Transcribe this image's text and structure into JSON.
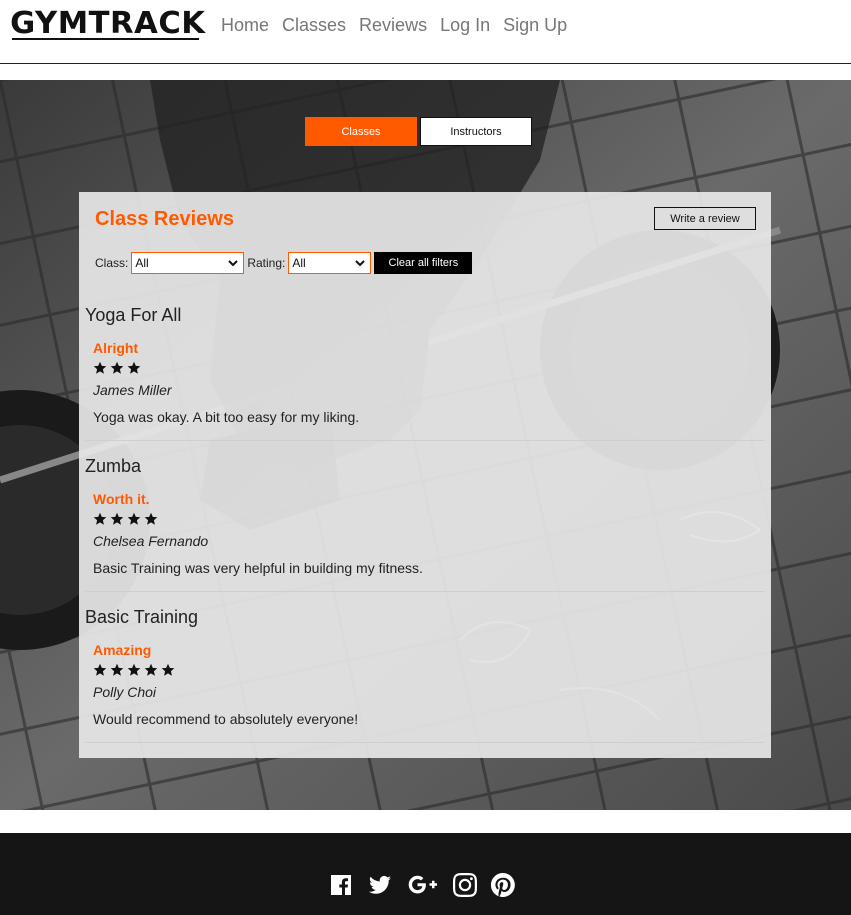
{
  "header": {
    "logo_text": "GYMTRACK",
    "nav": [
      "Home",
      "Classes",
      "Reviews",
      "Log In",
      "Sign Up"
    ]
  },
  "toggle": {
    "classes_label": "Classes",
    "instructors_label": "Instructors",
    "active": "Classes"
  },
  "panel": {
    "title": "Class Reviews",
    "write_label": "Write a review",
    "filters": {
      "class_label": "Class:",
      "class_value": "All",
      "rating_label": "Rating:",
      "rating_value": "All",
      "clear_label": "Clear all filters"
    },
    "reviews": [
      {
        "class_name": "Yoga For All",
        "title": "Alright",
        "rating": 3,
        "author": "James Miller",
        "body": "Yoga was okay. A bit too easy for my liking."
      },
      {
        "class_name": "Zumba",
        "title": "Worth it.",
        "rating": 4,
        "author": "Chelsea Fernando",
        "body": "Basic Training was very helpful in building my fitness."
      },
      {
        "class_name": "Basic Training",
        "title": "Amazing",
        "rating": 5,
        "author": "Polly Choi",
        "body": "Would recommend to absolutely everyone!"
      }
    ]
  },
  "footer": {
    "social_icons": [
      "facebook-icon",
      "twitter-icon",
      "google-plus-icon",
      "instagram-icon",
      "pinterest-icon"
    ]
  },
  "colors": {
    "accent": "#ff5a00",
    "footer_bg": "#151515"
  }
}
